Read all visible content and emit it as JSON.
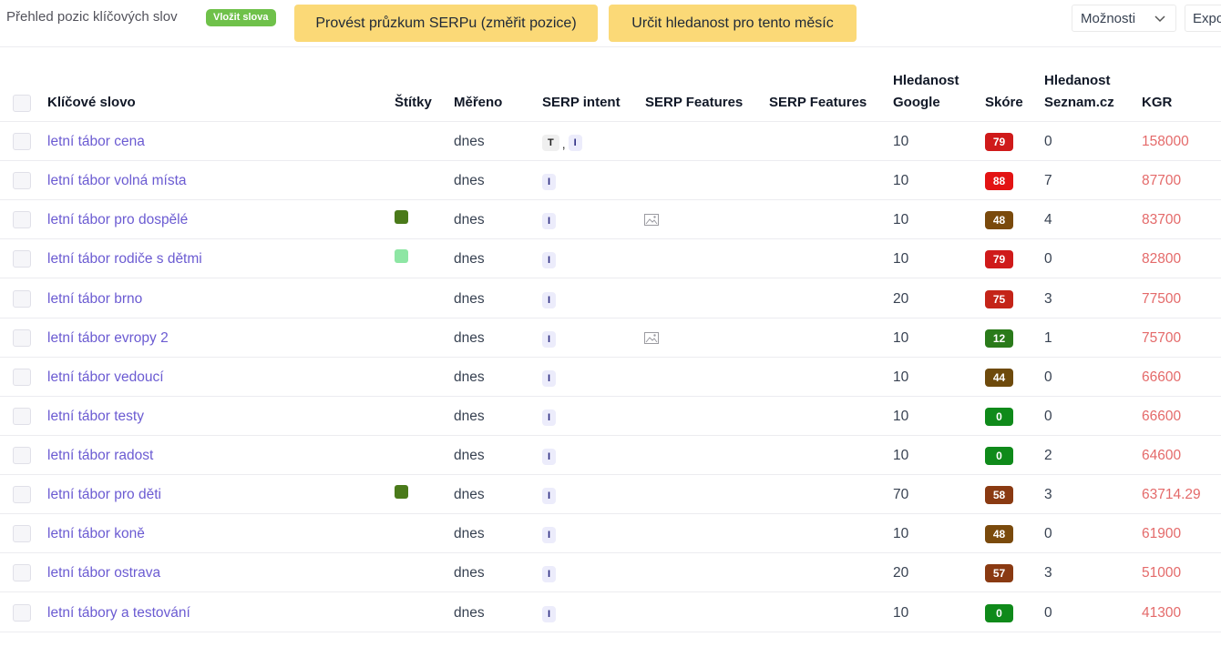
{
  "toolbar": {
    "title": "Přehled pozic klíčových slov",
    "insert_label": "Vložit slova",
    "serp_button_label": "Provést průzkum SERPu (změřit pozice)",
    "volume_button_label": "Určit hledanost pro tento měsíc",
    "options_label": "Možnosti",
    "export_label": "Export"
  },
  "colors": {
    "insert_badge": "#6fc14a",
    "yellow_button": "#fbd977",
    "keyword_link": "#6b5bd2",
    "kgr_value": "#e46a6a"
  },
  "table": {
    "columns": {
      "keyword": "Klíčové slovo",
      "tags": "Štítky",
      "measured": "Měřeno",
      "serp_intent": "SERP intent",
      "serp_features_1": "SERP Features",
      "serp_features_2": "SERP Features",
      "google_volume_1": "Hledanost",
      "google_volume_2": "Google",
      "score": "Skóre",
      "seznam_volume_1": "Hledanost",
      "seznam_volume_2": "Seznam.cz",
      "kgr": "KGR"
    },
    "rows": [
      {
        "keyword": "letní tábor cena",
        "tag": "",
        "measured": "dnes",
        "intent": [
          "T",
          "I"
        ],
        "feature": "",
        "google": "10",
        "score": "79",
        "score_color": "#cf1a1a",
        "seznam": "0",
        "kgr": "158000"
      },
      {
        "keyword": "letní tábor volná místa",
        "tag": "",
        "measured": "dnes",
        "intent": [
          "I"
        ],
        "feature": "",
        "google": "10",
        "score": "88",
        "score_color": "#e31313",
        "seznam": "7",
        "kgr": "87700"
      },
      {
        "keyword": "letní tábor pro dospělé",
        "tag": "#4a7a1a",
        "measured": "dnes",
        "intent": [
          "I"
        ],
        "feature": "image-icon",
        "google": "10",
        "score": "48",
        "score_color": "#7a4a0c",
        "seznam": "4",
        "kgr": "83700"
      },
      {
        "keyword": "letní tábor rodiče s dětmi",
        "tag": "#8ee6a4",
        "measured": "dnes",
        "intent": [
          "I"
        ],
        "feature": "",
        "google": "10",
        "score": "79",
        "score_color": "#cf1a1a",
        "seznam": "0",
        "kgr": "82800"
      },
      {
        "keyword": "letní tábor brno",
        "tag": "",
        "measured": "dnes",
        "intent": [
          "I"
        ],
        "feature": "",
        "google": "20",
        "score": "75",
        "score_color": "#c42418",
        "seznam": "3",
        "kgr": "77500"
      },
      {
        "keyword": "letní tábor evropy 2",
        "tag": "",
        "measured": "dnes",
        "intent": [
          "I"
        ],
        "feature": "image-icon",
        "google": "10",
        "score": "12",
        "score_color": "#2a7a1a",
        "seznam": "1",
        "kgr": "75700"
      },
      {
        "keyword": "letní tábor vedoucí",
        "tag": "",
        "measured": "dnes",
        "intent": [
          "I"
        ],
        "feature": "",
        "google": "10",
        "score": "44",
        "score_color": "#6e4a0c",
        "seznam": "0",
        "kgr": "66600"
      },
      {
        "keyword": "letní tábor testy",
        "tag": "",
        "measured": "dnes",
        "intent": [
          "I"
        ],
        "feature": "",
        "google": "10",
        "score": "0",
        "score_color": "#0f8a1a",
        "seznam": "0",
        "kgr": "66600"
      },
      {
        "keyword": "letní tábor radost",
        "tag": "",
        "measured": "dnes",
        "intent": [
          "I"
        ],
        "feature": "",
        "google": "10",
        "score": "0",
        "score_color": "#0f8a1a",
        "seznam": "2",
        "kgr": "64600"
      },
      {
        "keyword": "letní tábor pro děti",
        "tag": "#4a7a1a",
        "measured": "dnes",
        "intent": [
          "I"
        ],
        "feature": "",
        "google": "70",
        "score": "58",
        "score_color": "#8a3a12",
        "seznam": "3",
        "kgr": "63714.29"
      },
      {
        "keyword": "letní tábor koně",
        "tag": "",
        "measured": "dnes",
        "intent": [
          "I"
        ],
        "feature": "",
        "google": "10",
        "score": "48",
        "score_color": "#7a4a0c",
        "seznam": "0",
        "kgr": "61900"
      },
      {
        "keyword": "letní tábor ostrava",
        "tag": "",
        "measured": "dnes",
        "intent": [
          "I"
        ],
        "feature": "",
        "google": "20",
        "score": "57",
        "score_color": "#8a3a12",
        "seznam": "3",
        "kgr": "51000"
      },
      {
        "keyword": "letní tábory a testování",
        "tag": "",
        "measured": "dnes",
        "intent": [
          "I"
        ],
        "feature": "",
        "google": "10",
        "score": "0",
        "score_color": "#0f8a1a",
        "seznam": "0",
        "kgr": "41300"
      }
    ]
  }
}
